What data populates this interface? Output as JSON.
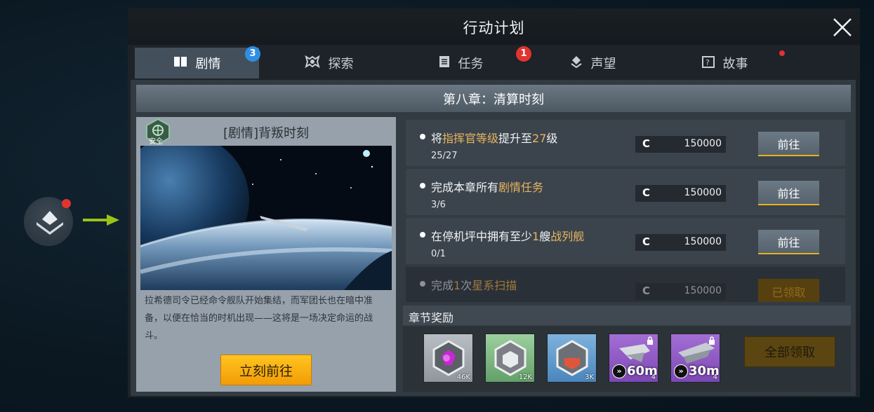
{
  "window": {
    "title": "行动计划"
  },
  "tabs": [
    {
      "label": "剧情",
      "icon": "book-icon",
      "badge": "3",
      "active": true
    },
    {
      "label": "探索",
      "icon": "explore-icon",
      "badge": null
    },
    {
      "label": "任务",
      "icon": "clipboard-icon",
      "badge": "1"
    },
    {
      "label": "声望",
      "icon": "reputation-icon",
      "badge": null
    },
    {
      "label": "故事",
      "icon": "story-icon",
      "badge": "dot"
    }
  ],
  "chapter": {
    "title": "第八章：清算时刻"
  },
  "story": {
    "safety_label": "安全",
    "title": "[剧情]背叛时刻",
    "text": "拉希德司令已经命令舰队开始集结，而军团长也在暗中准备，以便在恰当的时机出现——这将是一场决定命运的战斗。",
    "button": "立刻前往"
  },
  "tasks": [
    {
      "pre": "将",
      "hl1": "指挥官等级",
      "mid": "提升至",
      "hl2": "27",
      "post": "级",
      "progress": "25/27",
      "credit_symbol": "C",
      "reward": "150000",
      "action": "前往",
      "done": false
    },
    {
      "pre": "完成本章所有",
      "hl1": "剧情任务",
      "mid": "",
      "hl2": "",
      "post": "",
      "progress": "3/6",
      "credit_symbol": "C",
      "reward": "150000",
      "action": "前往",
      "done": false
    },
    {
      "pre": "在停机坪中拥有至少",
      "hl1": "1",
      "mid": "艘",
      "hl2": "战列舰",
      "post": "",
      "progress": "0/1",
      "credit_symbol": "C",
      "reward": "150000",
      "action": "前往",
      "done": false
    },
    {
      "pre": "完成",
      "hl1": "1",
      "mid": "次",
      "hl2": "星系扫描",
      "post": "",
      "progress": "",
      "credit_symbol": "C",
      "reward": "150000",
      "action": "已领取",
      "done": true
    }
  ],
  "rewards": {
    "title": "章节奖励",
    "items": [
      {
        "kind": "crystal",
        "qty": "46K"
      },
      {
        "kind": "metal",
        "qty": "12K"
      },
      {
        "kind": "deuterium",
        "qty": "3K"
      },
      {
        "kind": "speedup",
        "duration": "60m",
        "qty": "4",
        "locked": true
      },
      {
        "kind": "speedup",
        "duration": "30m",
        "qty": "4",
        "locked": true
      }
    ],
    "claim_all": "全部领取"
  },
  "colors": {
    "highlight": "#e8b460",
    "badge_blue": "#2f8ee6",
    "badge_red": "#e2342e",
    "primary_button": "#f39c06"
  }
}
